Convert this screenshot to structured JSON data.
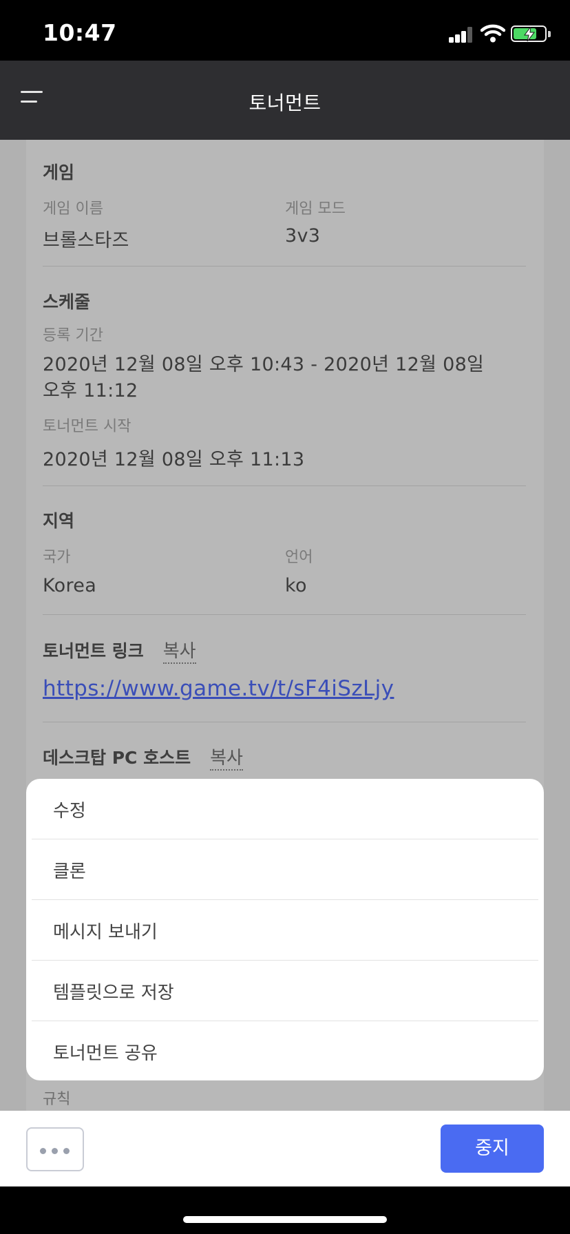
{
  "status_bar": {
    "time": "10:47",
    "battery_level": 0.75,
    "icons": [
      "signal-icon",
      "wifi-icon",
      "battery-charging-icon"
    ]
  },
  "header": {
    "title": "토너먼트",
    "menu_icon": "hamburger-menu-icon"
  },
  "game": {
    "title": "게임",
    "name_label": "게임 이름",
    "name_value": "브롤스타즈",
    "mode_label": "게임 모드",
    "mode_value": "3v3"
  },
  "schedule": {
    "title": "스케줄",
    "registration_label": "등록 기간",
    "registration_value_line1": "2020년 12월 08일 오후 10:43 - 2020년 12월 08일",
    "registration_value_line2": "오후 11:12",
    "start_label": "토너먼트 시작",
    "start_value": "2020년 12월 08일 오후 11:13"
  },
  "region": {
    "title": "지역",
    "country_label": "국가",
    "country_value": "Korea",
    "language_label": "언어",
    "language_value": "ko"
  },
  "tournament_link": {
    "title": "토너먼트 링크",
    "copy_label": "복사",
    "url": "https://www.game.tv/t/sF4iSzLjy"
  },
  "desktop_host": {
    "title": "데스크탑 PC 호스트",
    "copy_label": "복사"
  },
  "action_sheet": {
    "items": [
      {
        "label": "수정"
      },
      {
        "label": "클론"
      },
      {
        "label": "메시지 보내기"
      },
      {
        "label": "템플릿으로 저장"
      },
      {
        "label": "토너먼트 공유"
      }
    ]
  },
  "rules_label": "규칙",
  "bottom_bar": {
    "more_icon": "more-horizontal-icon",
    "stop_label": "중지"
  },
  "colors": {
    "header_bg": "#2e2e31",
    "accent": "#4a6bf2",
    "link": "#3a4eb8",
    "overlay_bg": "#b1b1b1",
    "battery_green": "#4cd964"
  }
}
